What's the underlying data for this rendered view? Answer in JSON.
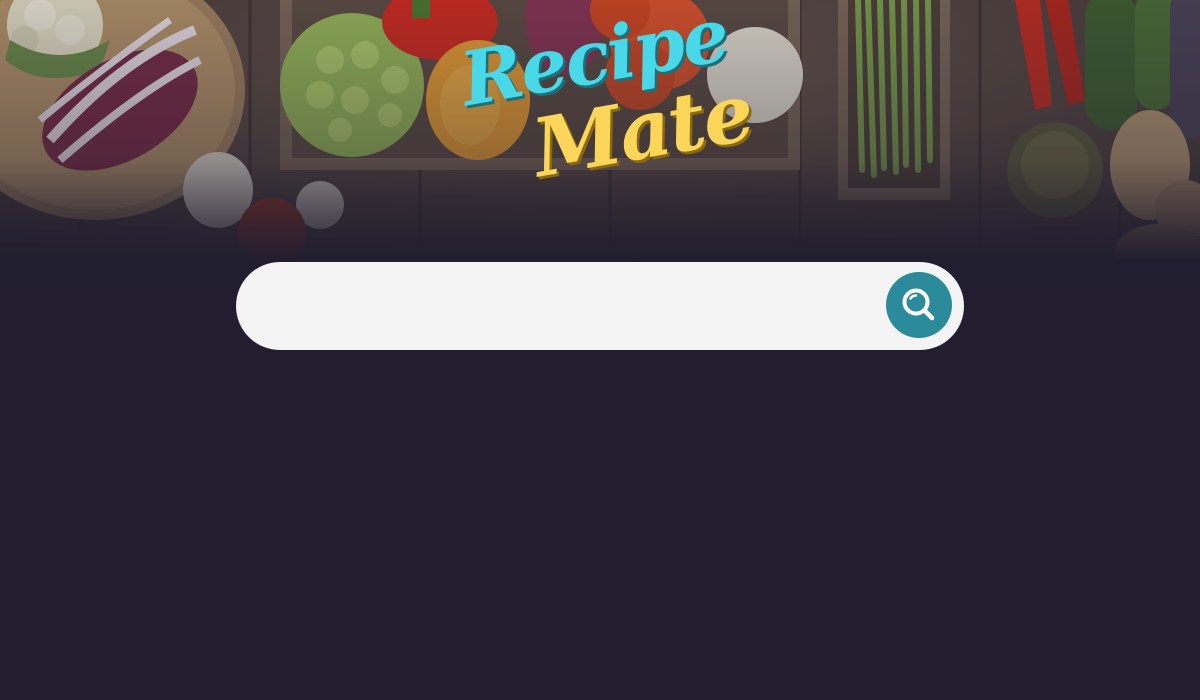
{
  "app": {
    "logo": {
      "line1": "Recipe",
      "line2": "Mate",
      "line1_color": "#48d8e8",
      "line2_color": "#fbd65a"
    }
  },
  "search": {
    "placeholder": "",
    "value": "",
    "button_icon": "search-icon",
    "button_color": "#2c8b9b"
  },
  "theme": {
    "background": "#221e2f",
    "search_bar_bg": "#f4f4f5"
  },
  "hero": {
    "image": "vegetables-on-wooden-table"
  }
}
